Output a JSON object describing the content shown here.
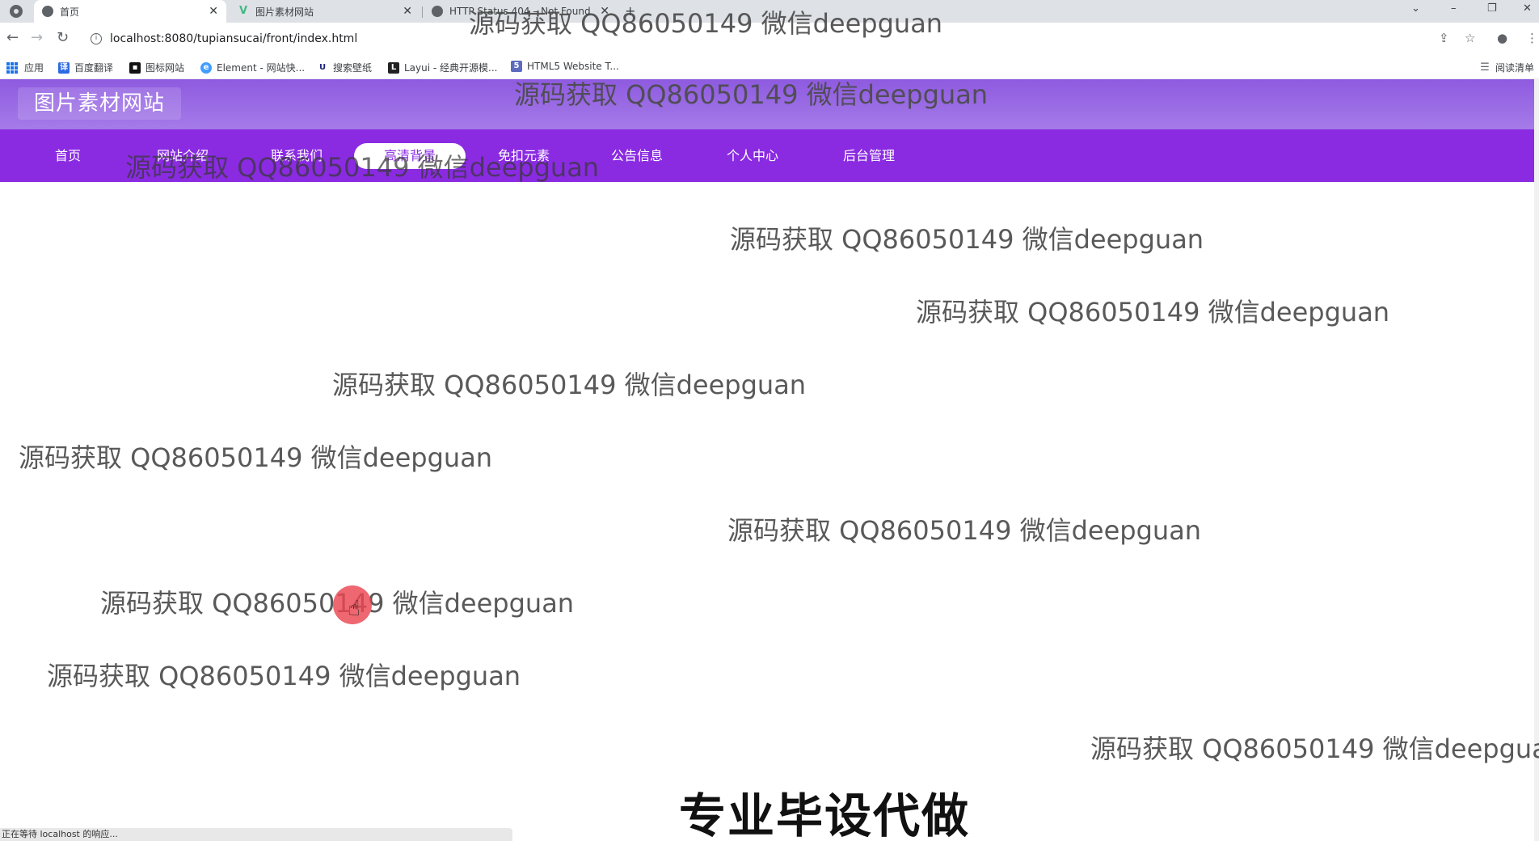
{
  "browser": {
    "tabs": [
      {
        "title": "首页",
        "active": true
      },
      {
        "title": "图片素材网站",
        "active": false
      },
      {
        "title": "HTTP Status 404 – Not Found",
        "active": false
      }
    ],
    "new_tab_symbol": "+",
    "window_controls": {
      "dropdown": "⌄",
      "minimize": "–",
      "restore": "❐",
      "close": "✕"
    },
    "url": "localhost:8080/tupiansucai/front/index.html",
    "bookmarks": [
      {
        "label": "应用",
        "icon": "apps-icon"
      },
      {
        "label": "百度翻译",
        "icon": "baidu-translate-icon",
        "color": "#2d6be4"
      },
      {
        "label": "图标网站",
        "icon": "iconfont-icon",
        "color": "#111111"
      },
      {
        "label": "Element - 网站快...",
        "icon": "element-icon",
        "color": "#409eff"
      },
      {
        "label": "搜索壁纸",
        "icon": "wallpaper-icon",
        "color": "#1a237e"
      },
      {
        "label": "Layui - 经典开源模...",
        "icon": "layui-icon",
        "color": "#222222"
      },
      {
        "label": "HTML5 Website T...",
        "icon": "html5-icon",
        "color": "#5c6bc0"
      }
    ],
    "reading_list": "阅读清单",
    "status_text": "正在等待 localhost 的响应..."
  },
  "site": {
    "logo": "图片素材网站",
    "nav": [
      {
        "label": "首页"
      },
      {
        "label": "网站介绍"
      },
      {
        "label": "联系我们"
      },
      {
        "label": "高清背景",
        "active": true
      },
      {
        "label": "免扣元素"
      },
      {
        "label": "公告信息"
      },
      {
        "label": "个人中心"
      },
      {
        "label": "后台管理"
      }
    ],
    "brand_color": "#8a2be2"
  },
  "overlay": {
    "watermark": "源码获取 QQ86050149 微信deepguan",
    "caption": "专业毕设代做"
  }
}
